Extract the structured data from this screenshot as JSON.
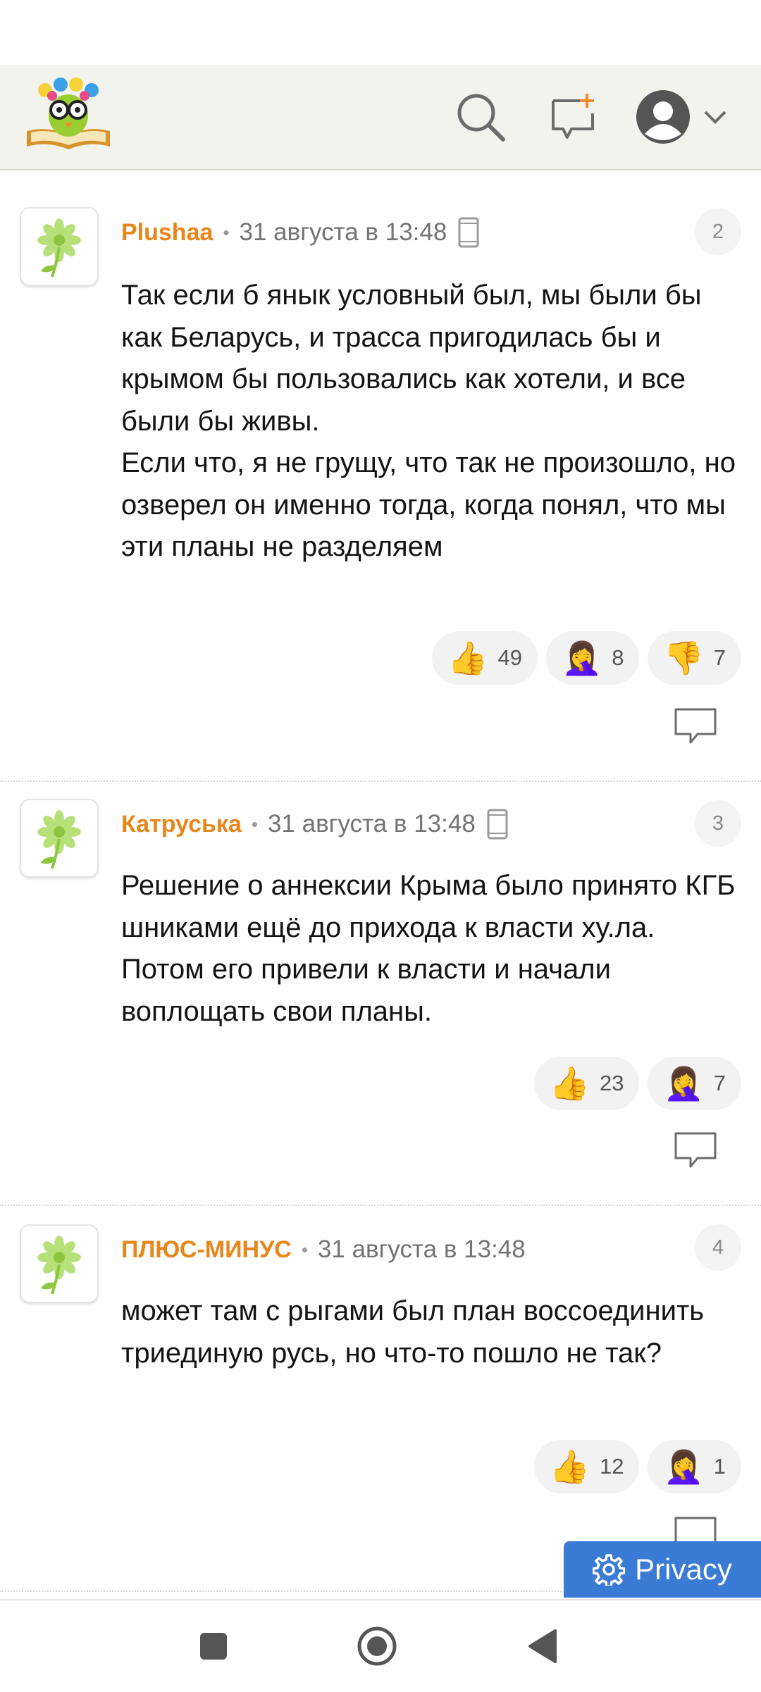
{
  "header": {
    "logo_icon": "owl-reading-book-logo",
    "search_icon": "search-icon",
    "new_post_icon": "new-message-icon",
    "profile_icon": "user-avatar-icon",
    "dropdown_icon": "chevron-down-icon"
  },
  "comments": [
    {
      "author": "Plushaa",
      "time": "31 августа в 13:48",
      "device_icon": "phone-icon",
      "number": "2",
      "text": "Так если б янык условный был, мы были бы как Беларусь, и трасса пригодилась бы и крымом бы пользовались как хотели, и все были бы живы.\nЕсли что, я не грущу, что так не произошло, но озверел он именно тогда, когда понял, что мы эти планы не разделяем",
      "reactions": [
        {
          "emoji": "👍",
          "count": "49"
        },
        {
          "emoji": "🤦‍♀️",
          "count": "8"
        },
        {
          "emoji": "👎",
          "count": "7"
        }
      ]
    },
    {
      "author": "Катруська",
      "time": "31 августа в 13:48",
      "device_icon": "phone-icon",
      "number": "3",
      "text": "Решение о аннексии Крыма было принято КГБ шниками ещё до прихода к власти ху.ла. Потом его привели к власти и начали воплощать свои планы.",
      "reactions": [
        {
          "emoji": "👍",
          "count": "23"
        },
        {
          "emoji": "🤦‍♀️",
          "count": "7"
        }
      ]
    },
    {
      "author": "ПЛЮС-МИНУС",
      "time": "31 августа в 13:48",
      "number": "4",
      "text": "может там с рыгами был план воссоединить триединую русь, но что-то пошло не так?",
      "reactions": [
        {
          "emoji": "👍",
          "count": "12"
        },
        {
          "emoji": "🤦‍♀️",
          "count": "1"
        }
      ]
    }
  ],
  "meta_separator": "•",
  "privacy": {
    "label": "Privacy",
    "icon": "gear-icon"
  },
  "navbar": {
    "icons": [
      "recent-apps-icon",
      "home-icon",
      "back-icon"
    ]
  },
  "colors": {
    "author": "#e8861a",
    "header_bg": "#f3f3ee",
    "privacy_bg": "#3a7bd5"
  }
}
